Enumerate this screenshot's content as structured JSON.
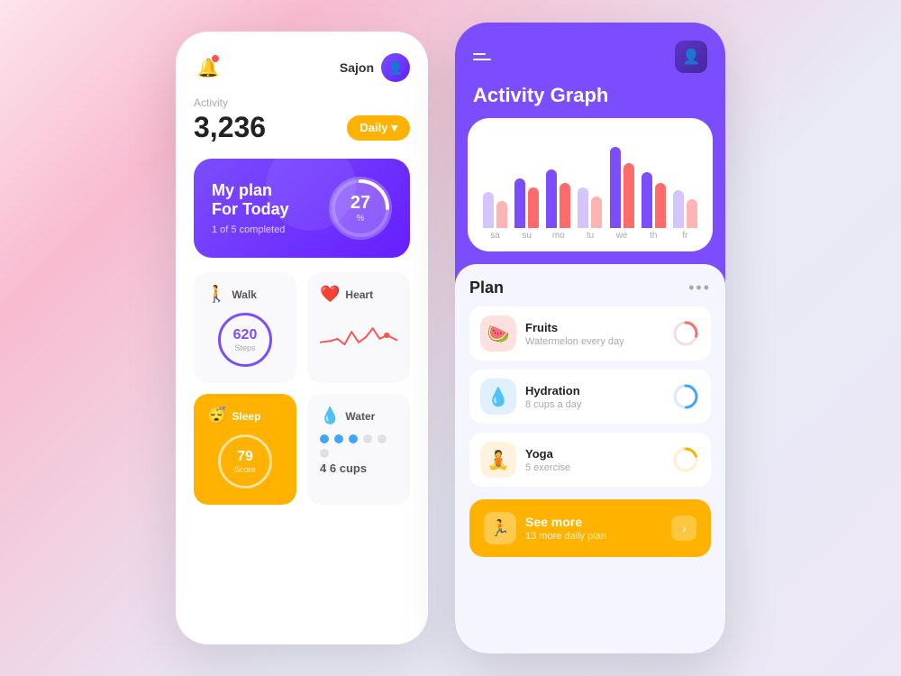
{
  "left_phone": {
    "user_name": "Sajon",
    "activity_label": "Activity",
    "activity_count": "3,236",
    "daily_btn": "Daily",
    "plan": {
      "title": "My plan",
      "subtitle": "For Today",
      "progress_text": "1 of 5 completed",
      "percent": "27",
      "percent_sign": "%"
    },
    "metrics": {
      "walk": {
        "title": "Walk",
        "value": "620",
        "unit": "Steps"
      },
      "heart": {
        "title": "Heart"
      },
      "sleep": {
        "title": "Sleep",
        "value": "79",
        "unit": "Score"
      },
      "water": {
        "title": "Water",
        "filled": 4,
        "total": 6,
        "label": "cups"
      }
    }
  },
  "right_phone": {
    "title": "Activity Graph",
    "chart": {
      "days": [
        "sa",
        "su",
        "mo",
        "tu",
        "we",
        "th",
        "fr"
      ],
      "bars": [
        {
          "purple": 40,
          "coral": 30
        },
        {
          "purple": 55,
          "coral": 45
        },
        {
          "purple": 70,
          "coral": 60
        },
        {
          "purple": 50,
          "coral": 40
        },
        {
          "purple": 90,
          "coral": 75
        },
        {
          "purple": 65,
          "coral": 55
        },
        {
          "purple": 45,
          "coral": 35
        }
      ]
    },
    "plan_section": {
      "title": "Plan",
      "items": [
        {
          "name": "Fruits",
          "desc": "Watermelon every day",
          "icon": "🍉",
          "icon_class": "fruits",
          "progress": 30
        },
        {
          "name": "Hydration",
          "desc": "8 cups a day",
          "icon": "💧",
          "icon_class": "hydration",
          "progress": 50
        },
        {
          "name": "Yoga",
          "desc": "5 exercise",
          "icon": "🧘",
          "icon_class": "yoga",
          "progress": 20
        }
      ]
    },
    "see_more": {
      "title": "See more",
      "subtitle": "13 more daily plan"
    }
  }
}
